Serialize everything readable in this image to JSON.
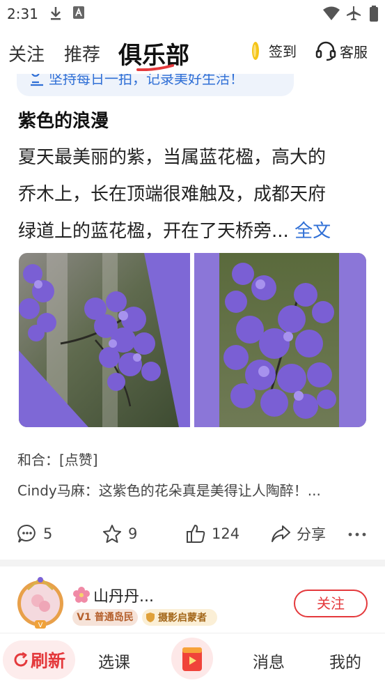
{
  "status_bar": {
    "time": "2:31"
  },
  "header": {
    "tabs": [
      {
        "label": "关注",
        "active": false
      },
      {
        "label": "推荐",
        "active": false
      },
      {
        "label": "俱乐部",
        "active": true
      }
    ],
    "checkin_label": "签到",
    "service_label": "客服"
  },
  "tip_banner": {
    "text": "坚持每日一拍，记录美好生活！"
  },
  "post": {
    "title": "紫色的浪漫",
    "body_lines": [
      " 夏天最美丽的紫，当属蓝花楹，高大的",
      "乔木上，长在顶端很难触及，成都天府",
      "绿道上的蓝花楹，开在了天桥旁..."
    ],
    "full_text_link": "全文",
    "comments": [
      {
        "text": "和合：[点赞]"
      },
      {
        "text": "Cindy马麻：这紫色的花朵真是美得让人陶醉！..."
      }
    ],
    "actions": {
      "comments_count": "5",
      "favorites_count": "9",
      "likes_count": "124",
      "share_label": "分享"
    }
  },
  "author": {
    "name": "山丹丹...",
    "level_badge": "V1 普通岛民",
    "title_badge": "摄影启蒙者",
    "follow_label": "关注"
  },
  "bottom_nav": {
    "refresh_label": "刷新",
    "course_label": "选课",
    "messages_label": "消息",
    "mine_label": "我的"
  },
  "colors": {
    "accent_red": "#e4393c",
    "link_blue": "#2f6fd6",
    "flower_purple": "#7b62d8"
  }
}
